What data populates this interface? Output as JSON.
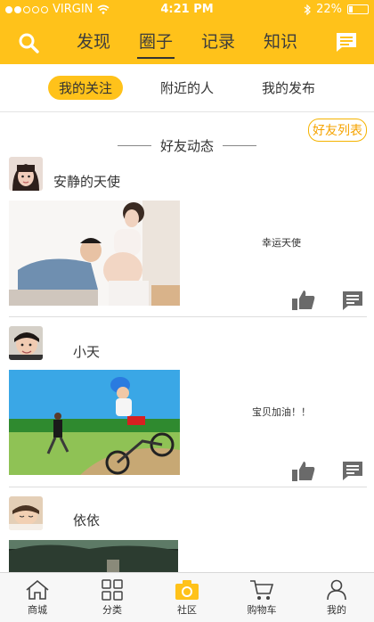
{
  "status_bar": {
    "carrier": "VIRGIN",
    "time": "4:21 PM",
    "battery": "22%",
    "battery_level": 0.22
  },
  "nav": {
    "tabs": [
      {
        "label": "发现",
        "active": false
      },
      {
        "label": "圈子",
        "active": true
      },
      {
        "label": "记录",
        "active": false
      },
      {
        "label": "知识",
        "active": false
      }
    ]
  },
  "subtabs": [
    {
      "label": "我的关注",
      "active": true
    },
    {
      "label": "附近的人",
      "active": false
    },
    {
      "label": "我的发布",
      "active": false
    }
  ],
  "friend_list_label": "好友列表",
  "section_title": "好友动态",
  "posts": [
    {
      "username": "安静的天使",
      "caption": "幸运天使"
    },
    {
      "username": "小天",
      "caption": "宝贝加油！！"
    },
    {
      "username": "依依",
      "caption": ""
    }
  ],
  "bottom_nav": [
    {
      "label": "商城",
      "icon": "home-icon"
    },
    {
      "label": "分类",
      "icon": "grid-icon"
    },
    {
      "label": "社区",
      "icon": "camera-icon"
    },
    {
      "label": "购物车",
      "icon": "cart-icon"
    },
    {
      "label": "我的",
      "icon": "person-icon"
    }
  ],
  "colors": {
    "accent": "#ffc21a",
    "accent_text": "#f5a300"
  }
}
